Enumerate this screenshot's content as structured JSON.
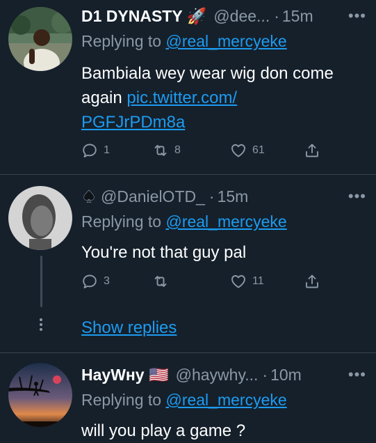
{
  "tweets": [
    {
      "display_name": "D1 DYNASTY 🚀",
      "handle": "@dee...",
      "time": "15m",
      "replying_prefix": "Replying to ",
      "replying_to": "@real_mercyeke",
      "text_line1": "Bambiala wey wear wig don come",
      "text_line2": "again ",
      "link_part1": "pic.twitter.com/",
      "link_part2": "PGFJrPDm8a",
      "reply_count": "1",
      "retweet_count": "8",
      "like_count": "61"
    },
    {
      "handle": "@DanielOTD_",
      "time": "15m",
      "replying_prefix": "Replying to ",
      "replying_to": "@real_mercyeke",
      "text": "You're not that guy pal",
      "reply_count": "3",
      "retweet_count": "",
      "like_count": "11",
      "show_replies": "Show replies"
    },
    {
      "display_name": "HayWнy 🇺🇸",
      "handle": "@haywhy...",
      "time": "10m",
      "replying_prefix": "Replying to ",
      "replying_to": "@real_mercyeke",
      "text": "will you play a game ?"
    }
  ],
  "separator": "·",
  "more_glyph": "•••",
  "icons": {
    "reply": "reply-icon",
    "retweet": "retweet-icon",
    "like": "heart-icon",
    "share": "share-icon",
    "more": "more-icon",
    "spade": "spade-icon"
  },
  "colors": {
    "background": "#15202b",
    "muted": "#8b98a5",
    "link": "#1d9bf0",
    "divider": "#38444d"
  }
}
